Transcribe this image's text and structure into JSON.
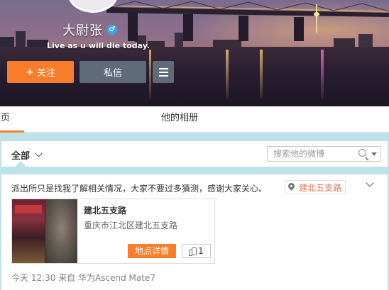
{
  "profile": {
    "name": "大尉张",
    "gender_icon": "male-icon",
    "gender_symbol": "♂",
    "motto": "Live as u will die today.",
    "follow_label": "关注",
    "follow_icon": "plus-icon",
    "message_label": "私信",
    "menu_icon": "hamburger-menu-icon"
  },
  "tabs": [
    {
      "label": "主页",
      "active": true
    },
    {
      "label": "他的相册",
      "active": false
    }
  ],
  "filter": {
    "all_label": "全部",
    "search_placeholder": "搜索他的微博"
  },
  "post": {
    "text": "派出所只是找我了解相关情况，大家不要过多猜测，感谢大家关心。",
    "location_tag": "建北五支路",
    "place": {
      "title": "建北五支路",
      "address": "重庆市江北区建北五支路",
      "detail_label": "地点详情",
      "like_count": "1"
    },
    "meta": "今天 12:30 来自 华为Ascend Mate7"
  },
  "colors": {
    "accent": "#f87e2c",
    "dark_button": "#5f6a7b",
    "background": "#bfe2ea",
    "location_text": "#eb7350"
  }
}
